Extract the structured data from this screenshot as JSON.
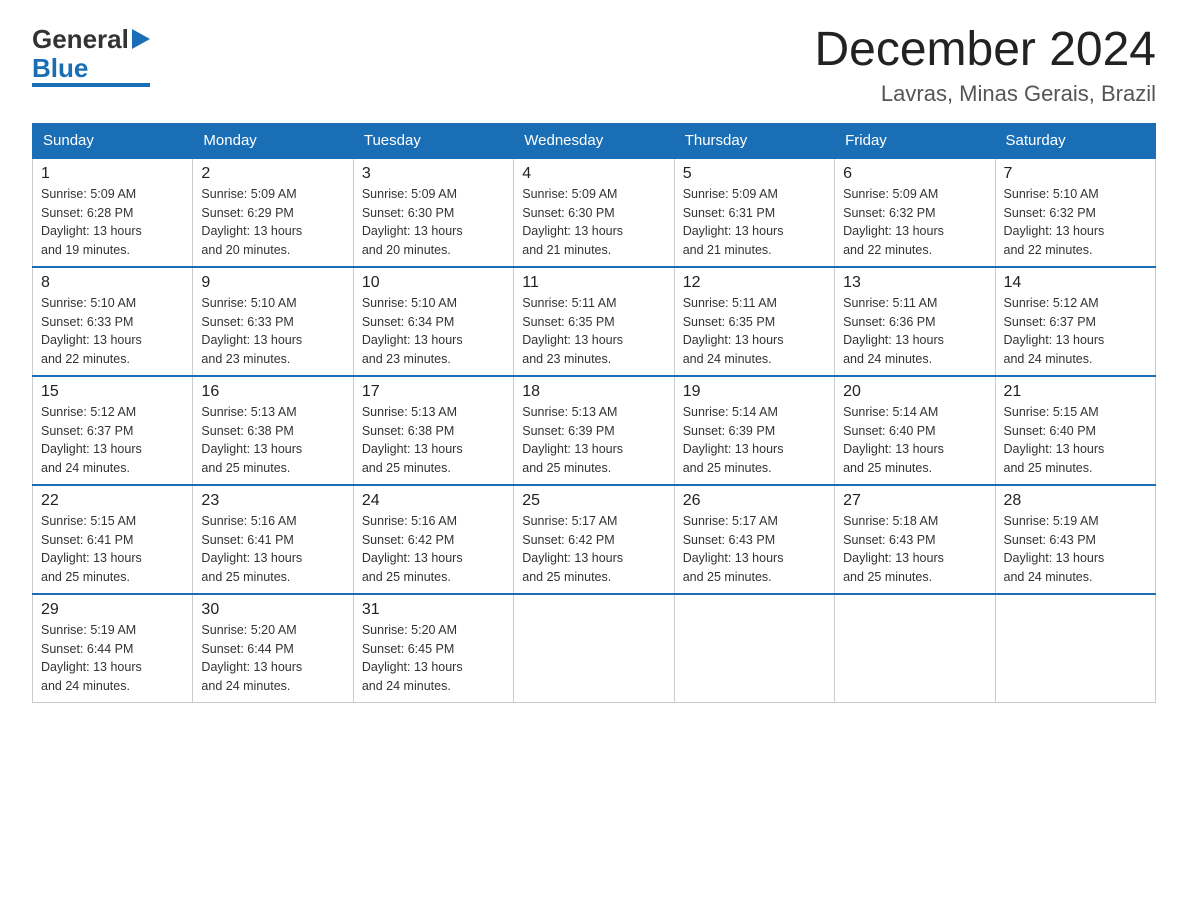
{
  "logo": {
    "text_general": "General",
    "text_blue": "Blue"
  },
  "title": "December 2024",
  "subtitle": "Lavras, Minas Gerais, Brazil",
  "weekdays": [
    "Sunday",
    "Monday",
    "Tuesday",
    "Wednesday",
    "Thursday",
    "Friday",
    "Saturday"
  ],
  "weeks": [
    [
      {
        "day": "1",
        "sunrise": "5:09 AM",
        "sunset": "6:28 PM",
        "daylight": "13 hours and 19 minutes."
      },
      {
        "day": "2",
        "sunrise": "5:09 AM",
        "sunset": "6:29 PM",
        "daylight": "13 hours and 20 minutes."
      },
      {
        "day": "3",
        "sunrise": "5:09 AM",
        "sunset": "6:30 PM",
        "daylight": "13 hours and 20 minutes."
      },
      {
        "day": "4",
        "sunrise": "5:09 AM",
        "sunset": "6:30 PM",
        "daylight": "13 hours and 21 minutes."
      },
      {
        "day": "5",
        "sunrise": "5:09 AM",
        "sunset": "6:31 PM",
        "daylight": "13 hours and 21 minutes."
      },
      {
        "day": "6",
        "sunrise": "5:09 AM",
        "sunset": "6:32 PM",
        "daylight": "13 hours and 22 minutes."
      },
      {
        "day": "7",
        "sunrise": "5:10 AM",
        "sunset": "6:32 PM",
        "daylight": "13 hours and 22 minutes."
      }
    ],
    [
      {
        "day": "8",
        "sunrise": "5:10 AM",
        "sunset": "6:33 PM",
        "daylight": "13 hours and 22 minutes."
      },
      {
        "day": "9",
        "sunrise": "5:10 AM",
        "sunset": "6:33 PM",
        "daylight": "13 hours and 23 minutes."
      },
      {
        "day": "10",
        "sunrise": "5:10 AM",
        "sunset": "6:34 PM",
        "daylight": "13 hours and 23 minutes."
      },
      {
        "day": "11",
        "sunrise": "5:11 AM",
        "sunset": "6:35 PM",
        "daylight": "13 hours and 23 minutes."
      },
      {
        "day": "12",
        "sunrise": "5:11 AM",
        "sunset": "6:35 PM",
        "daylight": "13 hours and 24 minutes."
      },
      {
        "day": "13",
        "sunrise": "5:11 AM",
        "sunset": "6:36 PM",
        "daylight": "13 hours and 24 minutes."
      },
      {
        "day": "14",
        "sunrise": "5:12 AM",
        "sunset": "6:37 PM",
        "daylight": "13 hours and 24 minutes."
      }
    ],
    [
      {
        "day": "15",
        "sunrise": "5:12 AM",
        "sunset": "6:37 PM",
        "daylight": "13 hours and 24 minutes."
      },
      {
        "day": "16",
        "sunrise": "5:13 AM",
        "sunset": "6:38 PM",
        "daylight": "13 hours and 25 minutes."
      },
      {
        "day": "17",
        "sunrise": "5:13 AM",
        "sunset": "6:38 PM",
        "daylight": "13 hours and 25 minutes."
      },
      {
        "day": "18",
        "sunrise": "5:13 AM",
        "sunset": "6:39 PM",
        "daylight": "13 hours and 25 minutes."
      },
      {
        "day": "19",
        "sunrise": "5:14 AM",
        "sunset": "6:39 PM",
        "daylight": "13 hours and 25 minutes."
      },
      {
        "day": "20",
        "sunrise": "5:14 AM",
        "sunset": "6:40 PM",
        "daylight": "13 hours and 25 minutes."
      },
      {
        "day": "21",
        "sunrise": "5:15 AM",
        "sunset": "6:40 PM",
        "daylight": "13 hours and 25 minutes."
      }
    ],
    [
      {
        "day": "22",
        "sunrise": "5:15 AM",
        "sunset": "6:41 PM",
        "daylight": "13 hours and 25 minutes."
      },
      {
        "day": "23",
        "sunrise": "5:16 AM",
        "sunset": "6:41 PM",
        "daylight": "13 hours and 25 minutes."
      },
      {
        "day": "24",
        "sunrise": "5:16 AM",
        "sunset": "6:42 PM",
        "daylight": "13 hours and 25 minutes."
      },
      {
        "day": "25",
        "sunrise": "5:17 AM",
        "sunset": "6:42 PM",
        "daylight": "13 hours and 25 minutes."
      },
      {
        "day": "26",
        "sunrise": "5:17 AM",
        "sunset": "6:43 PM",
        "daylight": "13 hours and 25 minutes."
      },
      {
        "day": "27",
        "sunrise": "5:18 AM",
        "sunset": "6:43 PM",
        "daylight": "13 hours and 25 minutes."
      },
      {
        "day": "28",
        "sunrise": "5:19 AM",
        "sunset": "6:43 PM",
        "daylight": "13 hours and 24 minutes."
      }
    ],
    [
      {
        "day": "29",
        "sunrise": "5:19 AM",
        "sunset": "6:44 PM",
        "daylight": "13 hours and 24 minutes."
      },
      {
        "day": "30",
        "sunrise": "5:20 AM",
        "sunset": "6:44 PM",
        "daylight": "13 hours and 24 minutes."
      },
      {
        "day": "31",
        "sunrise": "5:20 AM",
        "sunset": "6:45 PM",
        "daylight": "13 hours and 24 minutes."
      },
      null,
      null,
      null,
      null
    ]
  ],
  "labels": {
    "sunrise": "Sunrise:",
    "sunset": "Sunset:",
    "daylight": "Daylight:"
  }
}
